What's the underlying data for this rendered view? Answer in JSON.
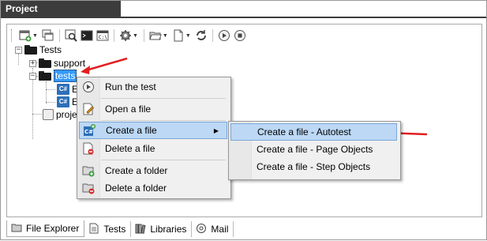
{
  "window": {
    "title": "Project"
  },
  "toolbar": {
    "buttons": [
      {
        "icon": "new-project-icon"
      },
      {
        "icon": "windows-icon"
      },
      {
        "icon": "inspect-icon"
      },
      {
        "icon": "console-icon"
      },
      {
        "icon": "command-icon"
      },
      {
        "icon": "settings-gear-icon"
      },
      {
        "icon": "open-folder-icon"
      },
      {
        "icon": "new-file-icon"
      },
      {
        "icon": "refresh-icon"
      },
      {
        "icon": "run-icon"
      },
      {
        "icon": "stop-icon"
      }
    ]
  },
  "tree": {
    "root": {
      "label": "Tests"
    },
    "support": {
      "label": "support"
    },
    "tests": {
      "label": "tests"
    },
    "child1": {
      "label": "E"
    },
    "child2": {
      "label": "E"
    },
    "project": {
      "label": "proje"
    }
  },
  "context_menu": {
    "items": [
      {
        "label": "Run the test",
        "icon": "run-icon"
      },
      {
        "label": "Open a file",
        "icon": "edit-file-icon"
      },
      {
        "label": "Create a file",
        "icon": "create-file-icon",
        "submenu_arrow": "▶"
      },
      {
        "label": "Delete a file",
        "icon": "delete-file-icon"
      },
      {
        "label": "Create a folder",
        "icon": "create-folder-icon"
      },
      {
        "label": "Delete a folder",
        "icon": "delete-folder-icon"
      }
    ]
  },
  "submenu": {
    "items": [
      {
        "label": "Create a file - Autotest"
      },
      {
        "label": "Create a file - Page Objects"
      },
      {
        "label": "Create a file - Step Objects"
      }
    ]
  },
  "tabs": [
    {
      "label": "File Explorer",
      "icon": "file-explorer-icon",
      "active": true
    },
    {
      "label": "Tests",
      "icon": "tests-icon",
      "active": false
    },
    {
      "label": "Libraries",
      "icon": "libraries-icon",
      "active": false
    },
    {
      "label": "Mail",
      "icon": "mail-icon",
      "active": false
    }
  ],
  "colors": {
    "annotation_arrow": "#e02020",
    "selection": "#3399ff",
    "menu_highlight": "#bcd8f5"
  }
}
